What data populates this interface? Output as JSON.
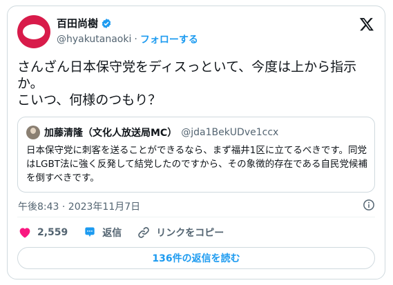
{
  "author": {
    "display_name": "百田尚樹",
    "handle": "@hyakutanaoki",
    "separator": "·",
    "follow_label": "フォローする"
  },
  "tweet": {
    "text": "さんざん日本保守党をディスっといて、今度は上から指示か。\nこいつ、何様のつもり？"
  },
  "quote": {
    "display_name": "加藤清隆（文化人放送局MC）",
    "handle": "@jda1BekUDve1ccx",
    "text": "日本保守党に刺客を送ることができるなら、まず福井1区に立てるべきです。同党はLGBT法に強く反発して結党したのですから、その象徴的存在である自民党候補を倒すべきです。"
  },
  "meta": {
    "timestamp": "午後8:43 · 2023年11月7日"
  },
  "actions": {
    "like_count": "2,559",
    "reply_label": "返信",
    "copy_link_label": "リンクをコピー"
  },
  "replies_button_label": "136件の返信を読む",
  "colors": {
    "accent": "#1d9bf0",
    "like": "#f91880",
    "avatar": "#d81b4a",
    "muted_text": "#536471"
  },
  "icons": [
    "verified-badge-icon",
    "x-logo-icon",
    "info-icon",
    "heart-icon",
    "reply-bubble-icon",
    "link-icon"
  ]
}
